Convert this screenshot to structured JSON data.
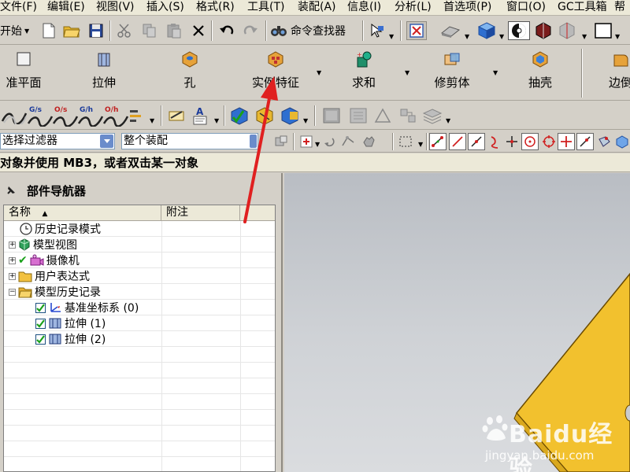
{
  "menubar": {
    "items": [
      "文件(F)",
      "编辑(E)",
      "视图(V)",
      "插入(S)",
      "格式(R)",
      "工具(T)",
      "装配(A)",
      "信息(I)",
      "分析(L)",
      "首选项(P)",
      "窗口(O)",
      "GC工具箱",
      "帮"
    ]
  },
  "toolbar1": {
    "start_label": "开始",
    "command_finder_label": "命令查找器"
  },
  "features": {
    "items": [
      "准平面",
      "拉伸",
      "孔",
      "实例特征",
      "求和",
      "修剪体",
      "抽壳",
      "边倒"
    ]
  },
  "filter": {
    "selection_filter": "选择过滤器",
    "assembly_scope": "整个装配"
  },
  "status": {
    "message": "对象并使用 MB3，或者双击某一对象"
  },
  "navigator": {
    "title": "部件导航器",
    "columns": [
      "名称",
      "附注"
    ],
    "nodes": [
      {
        "label": "历史记录模式",
        "icon": "clock-icon"
      },
      {
        "label": "模型视图",
        "icon": "model-views-icon"
      },
      {
        "label": "摄像机",
        "icon": "camera-icon"
      },
      {
        "label": "用户表达式",
        "icon": "folder-icon"
      },
      {
        "label": "模型历史记录",
        "icon": "folder-open-icon"
      },
      {
        "label": "基准坐标系 (0)",
        "icon": "datum-csys-icon"
      },
      {
        "label": "拉伸 (1)",
        "icon": "extrude-icon"
      },
      {
        "label": "拉伸 (2)",
        "icon": "extrude-icon"
      }
    ]
  },
  "watermark": {
    "brand": "Baidu经验",
    "url": "jingyan.baidu.com"
  },
  "colors": {
    "annotation_arrow": "#e02020",
    "part_face": "#f2c12e",
    "viewport_bg": "#c4c7cb"
  }
}
